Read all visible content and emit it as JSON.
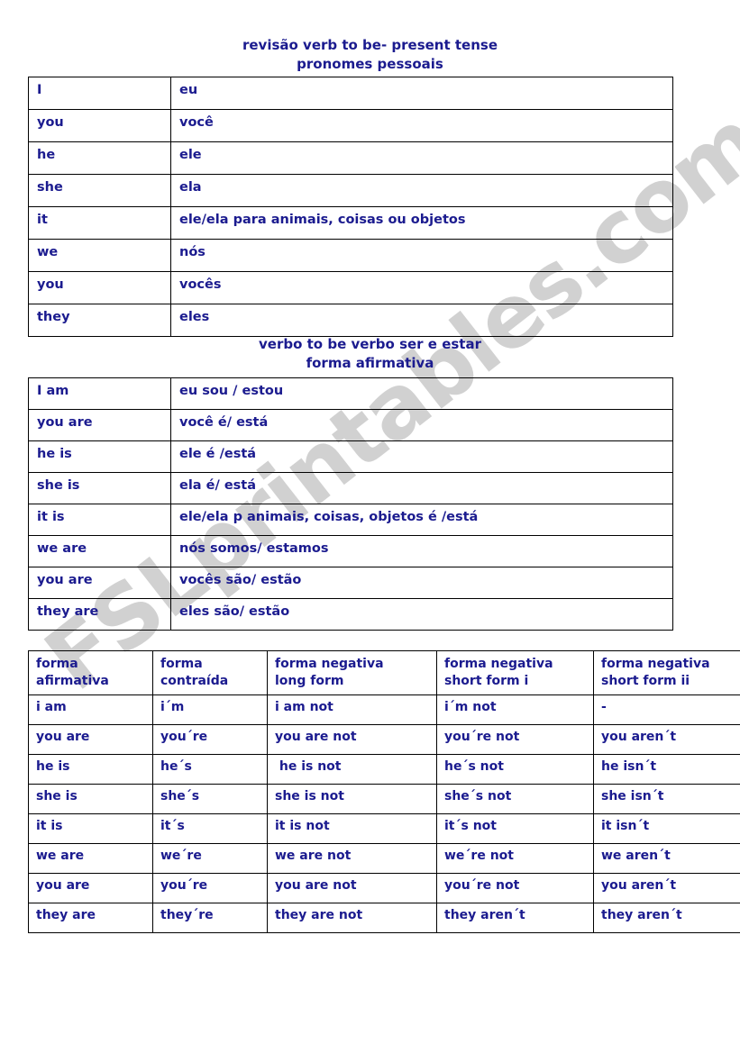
{
  "watermark": {
    "text": "FSLprintables.com"
  },
  "headings": {
    "pronouns": {
      "line1": "revisão verb to be- present tense",
      "line2": "pronomes pessoais"
    },
    "affirmative": {
      "line1": "verbo to be verbo ser e estar",
      "line2": "forma afirmativa"
    }
  },
  "tables": {
    "pronouns": {
      "rows": [
        {
          "english": "I",
          "portuguese": "eu"
        },
        {
          "english": "you",
          "portuguese": "você"
        },
        {
          "english": "he",
          "portuguese": "ele"
        },
        {
          "english": "she",
          "portuguese": "ela"
        },
        {
          "english": "it",
          "portuguese": "ele/ela para animais, coisas ou objetos"
        },
        {
          "english": "we",
          "portuguese": "nós"
        },
        {
          "english": "you",
          "portuguese": "vocês"
        },
        {
          "english": "they",
          "portuguese": "eles"
        }
      ]
    },
    "affirmative": {
      "rows": [
        {
          "english": "I am",
          "portuguese": "eu sou / estou"
        },
        {
          "english": "you are",
          "portuguese": "você é/ está"
        },
        {
          "english": "he is",
          "portuguese": "ele é /está"
        },
        {
          "english": "she is",
          "portuguese": "ela é/ está"
        },
        {
          "english": "it is",
          "portuguese": "ele/ela p animais, coisas, objetos é /está"
        },
        {
          "english": "we are",
          "portuguese": "nós somos/ estamos"
        },
        {
          "english": "you are",
          "portuguese": "vocês são/ estão"
        },
        {
          "english": "they are",
          "portuguese": "eles são/ estão"
        }
      ]
    },
    "forms": {
      "headers": [
        "forma\nafirmativa",
        "forma\ncontraída",
        "forma negativa\nlong form",
        "forma negativa\nshort form i",
        "forma negativa\nshort form ii"
      ],
      "rows": [
        [
          "i am",
          "i´m",
          "i am not",
          "i´m not",
          "-"
        ],
        [
          "you are",
          "you´re",
          "you are not",
          "you´re not",
          "you aren´t"
        ],
        [
          "he is",
          "he´s",
          " he is not",
          "he´s not",
          "he isn´t"
        ],
        [
          "she is",
          "she´s",
          "she is not",
          "she´s not",
          "she isn´t"
        ],
        [
          "it is",
          "it´s",
          "it is not",
          "it´s not",
          "it isn´t"
        ],
        [
          "we are",
          "we´re",
          "we are not",
          "we´re not",
          "we aren´t"
        ],
        [
          "you are",
          "you´re",
          "you are not",
          "you´re not",
          "you aren´t"
        ],
        [
          "they are",
          "they´re",
          "they are not",
          "they aren´t",
          "they aren´t"
        ]
      ]
    }
  }
}
